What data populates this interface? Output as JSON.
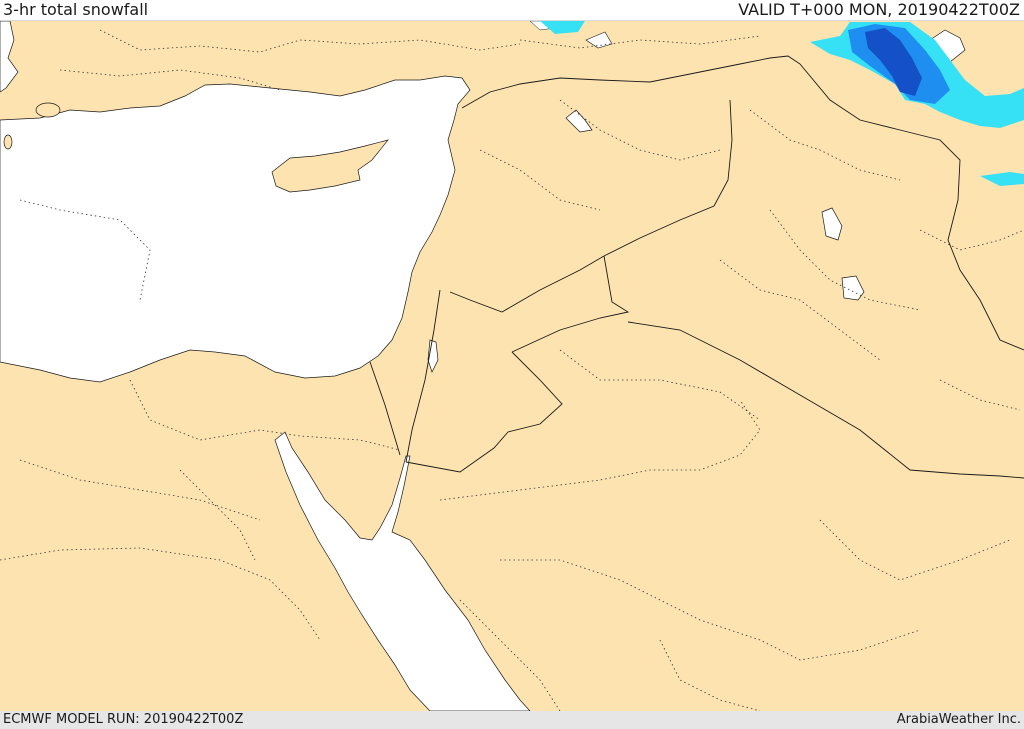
{
  "header": {
    "title": "3-hr total snowfall",
    "valid": "VALID T+000 MON, 20190422T00Z"
  },
  "footer": {
    "model_run": "ECMWF MODEL RUN: 20190422T00Z",
    "credit": "ArabiaWeather Inc."
  },
  "colors": {
    "land": "#fde3b0",
    "sea": "#ffffff",
    "border": "#1a1a1a",
    "snow_light": "#37e1f5",
    "snow_medium": "#1e8ff0",
    "snow_heavy": "#1450c8"
  }
}
